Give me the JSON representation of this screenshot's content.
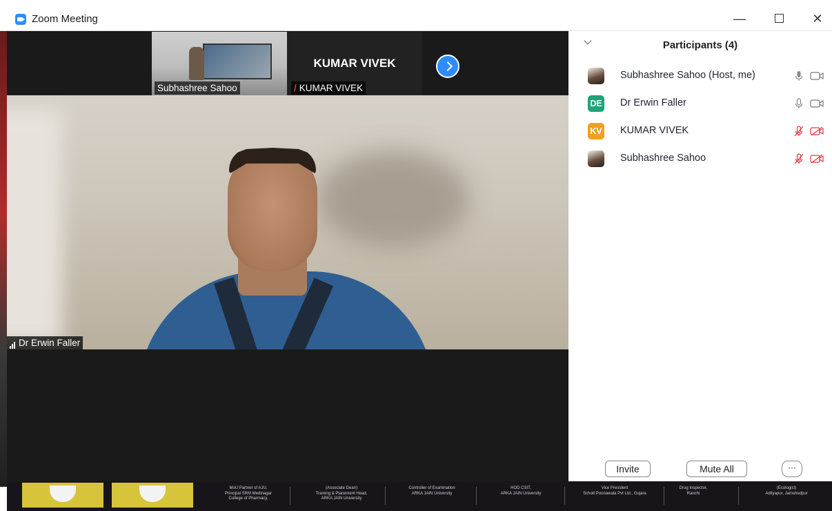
{
  "window": {
    "title": "Zoom Meeting"
  },
  "thumbnails": [
    {
      "name": "Subhashree Sahoo"
    },
    {
      "name": "KUMAR VIVEK",
      "display_name": "KUMAR VIVEK"
    }
  ],
  "speaker": {
    "name": "Dr Erwin Faller"
  },
  "participants": {
    "title": "Participants (4)",
    "list": [
      {
        "name": "Subhashree Sahoo (Host, me)",
        "avatar": "photo",
        "audio": "on",
        "video": "off"
      },
      {
        "name": "Dr Erwin Faller",
        "avatar_initials": "DE",
        "avatar_color": "#1fa378",
        "audio": "on",
        "video": "off"
      },
      {
        "name": "KUMAR VIVEK",
        "avatar_initials": "KV",
        "avatar_color": "#f0a01e",
        "audio": "muted",
        "video": "muted"
      },
      {
        "name": "Subhashree Sahoo",
        "avatar": "photo",
        "audio": "muted",
        "video": "muted"
      }
    ],
    "invite_label": "Invite",
    "mute_all_label": "Mute All",
    "more_label": "···"
  },
  "banner": {
    "cells": [
      [
        "MoU Partner of AJU,",
        "Principal SRM Medinagar",
        "College of Pharmacy,"
      ],
      [
        "(Associate Dean)",
        "Training & Placement Head,",
        "ARKA JAIN University"
      ],
      [
        "Controller of Examination",
        "ARKA JAIN University"
      ],
      [
        "HOD CSIT,",
        "ARKA JAIN University"
      ],
      [
        "Vice President",
        "Schott Poonawala Pvt Ltd., Gujara"
      ],
      [
        "Drug Inspector,",
        "Ranchi"
      ],
      [
        "(Ecologist)",
        "Adityapur, Jamshedpur"
      ]
    ]
  },
  "colors": {
    "accent": "#2d8cff",
    "muted": "#e0393e"
  }
}
